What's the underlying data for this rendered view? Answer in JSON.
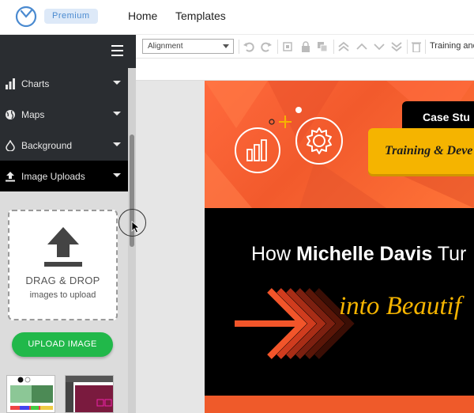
{
  "app": {
    "premium_badge": "Premium",
    "nav": [
      "Home",
      "Templates"
    ]
  },
  "sidebar": {
    "menu": [
      {
        "label": "Charts",
        "icon": "bar-chart-icon"
      },
      {
        "label": "Maps",
        "icon": "globe-icon"
      },
      {
        "label": "Background",
        "icon": "droplet-icon"
      },
      {
        "label": "Image Uploads",
        "icon": "upload-icon",
        "active": true
      }
    ],
    "dropzone": {
      "title": "DRAG & DROP",
      "subtitle": "images to upload"
    },
    "upload_button": "UPLOAD IMAGE"
  },
  "toolbar": {
    "alignment": "Alignment",
    "title_text": "Training and"
  },
  "design": {
    "case_study": "Case Stu",
    "training": "Training & Deve",
    "headline_pre": "How ",
    "headline_bold": "Michelle Davis",
    "headline_post": " Tur",
    "script": "into Beautif"
  },
  "colors": {
    "accent_green": "#21b84a",
    "brand_orange": "#f25a2c",
    "brand_yellow": "#f5b400",
    "sidebar_dark": "#2a2d31"
  }
}
